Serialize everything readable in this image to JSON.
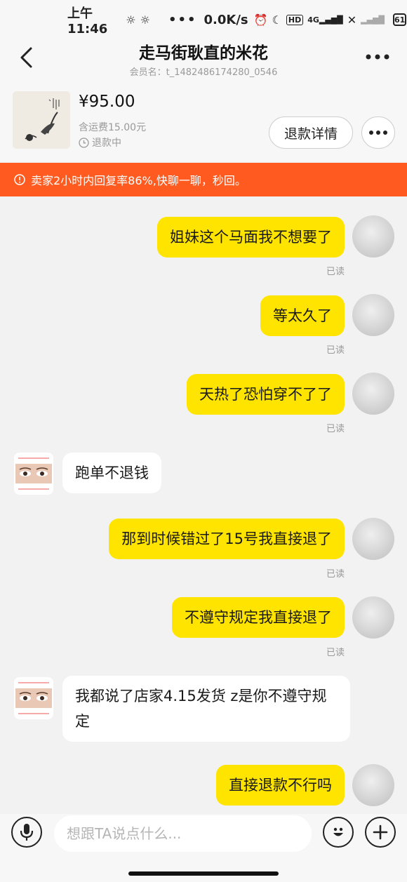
{
  "status_bar": {
    "time": "上午11:46",
    "dots": "•••",
    "speed": "0.0K/s",
    "network": "4G",
    "battery": "61"
  },
  "header": {
    "title": "走马街耿直的米花",
    "subtitle": "会员名：t_1482486174280_0546"
  },
  "product": {
    "price": "¥95.00",
    "shipping": "含运费15.00元",
    "refund_status": "退款中",
    "refund_button": "退款详情"
  },
  "notice": {
    "text": "卖家2小时内回复率86%,快聊一聊，秒回。"
  },
  "messages": [
    {
      "text": "姐妹这个马面我不想要了",
      "read": "已读"
    },
    {
      "text": "等太久了",
      "read": "已读"
    },
    {
      "text": "天热了恐怕穿不了了",
      "read": "已读"
    },
    {
      "text": "跑单不退钱"
    },
    {
      "text": "那到时候错过了15号我直接退了",
      "read": "已读"
    },
    {
      "text": "不遵守规定我直接退了",
      "read": "已读"
    },
    {
      "text": "我都说了店家4.15发货 z是你不遵守规定"
    },
    {
      "text": "直接退款不行吗"
    }
  ],
  "input": {
    "placeholder": "想跟TA说点什么..."
  }
}
